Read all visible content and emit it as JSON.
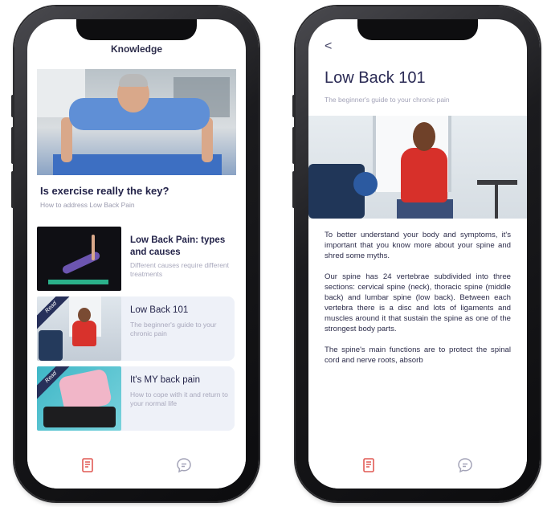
{
  "left_screen": {
    "header_title": "Knowledge",
    "featured": {
      "title": "Is exercise really the key?",
      "subtitle": "How to address Low Back Pain"
    },
    "cards": [
      {
        "title": "Low Back Pain: types and causes",
        "description": "Different causes require different treatments",
        "badge": ""
      },
      {
        "title": "Low Back 101",
        "description": "The beginner's guide to your chronic pain",
        "badge": "Read"
      },
      {
        "title": "It's MY back pain",
        "description": "How to cope with it and return to your normal life",
        "badge": "Read"
      }
    ],
    "tabbar": {
      "tabs": [
        {
          "icon": "book-icon",
          "active": true
        },
        {
          "icon": "chat-bubble-icon",
          "active": false
        }
      ]
    }
  },
  "right_screen": {
    "back_icon": "chevron-left-icon",
    "back_glyph": "<",
    "title": "Low Back 101",
    "subtitle": "The beginner's guide to your chronic pain",
    "paragraphs": [
      "To better understand your body and symptoms, it's important that you know more about your spine and shred some myths.",
      "Our spine has 24 vertebrae subdivided into three sections: cervical spine (neck), thoracic spine (middle back) and lumbar spine (low back). Between each vertebra there is a disc and lots of ligaments and muscles around it that sustain the spine as one of the strongest body parts.",
      "The spine's main functions are to protect the spinal cord and nerve roots, absorb"
    ],
    "tabbar": {
      "tabs": [
        {
          "icon": "book-icon",
          "active": true
        },
        {
          "icon": "chat-bubble-icon",
          "active": false
        }
      ]
    }
  },
  "colors": {
    "accent": "#e15a55",
    "text_primary": "#24244a",
    "text_muted": "#a8a8bc",
    "card_bg": "#eef1f8",
    "badge_bg": "#27305a"
  }
}
